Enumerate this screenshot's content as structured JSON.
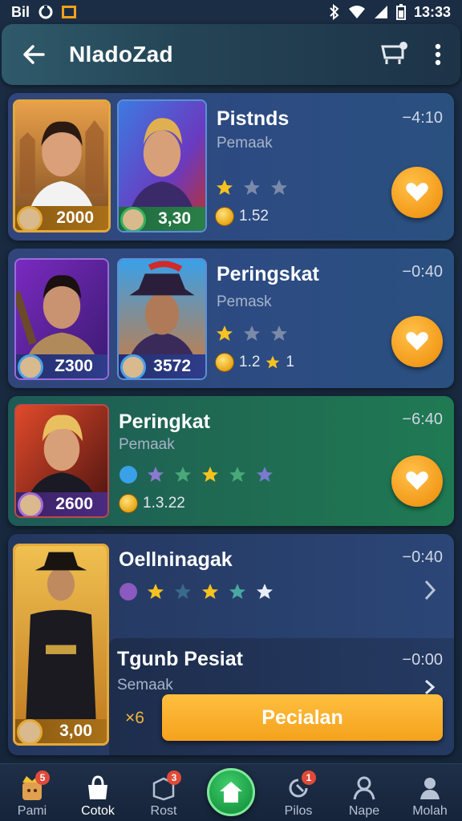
{
  "status_bar": {
    "left_text": "Bil",
    "time": "13:33"
  },
  "app_bar": {
    "title": "NladoZad",
    "back_icon": "arrow-left-icon",
    "cart_icon": "cart-icon",
    "menu_icon": "more-vertical-icon"
  },
  "cards": [
    {
      "title": "Pistnds",
      "subtitle": "Pemaak",
      "time": "−4:10",
      "portraits": [
        {
          "value": "2000"
        },
        {
          "value": "3,30"
        }
      ],
      "stars": 3,
      "coins": "1.52",
      "action_icon": "heart-icon"
    },
    {
      "title": "Peringskat",
      "subtitle": "Pemask",
      "time": "−0:40",
      "portraits": [
        {
          "value": "Z300"
        },
        {
          "value": "3572"
        }
      ],
      "stars": 3,
      "coins": "1.2",
      "coins_extra": "1",
      "action_icon": "heart-icon"
    },
    {
      "title": "Peringkat",
      "subtitle": "Pemaak",
      "time": "−6:40",
      "portraits": [
        {
          "value": "2600"
        }
      ],
      "stars": 6,
      "coins": "1.3.22",
      "action_icon": "heart-icon"
    },
    {
      "title": "Oellninagak",
      "time": "−0:40",
      "portraits": [
        {
          "value": "3,00"
        }
      ],
      "stars": 5,
      "action_icon": "chevron-right-icon"
    },
    {
      "title": "Tgunb Pesiat",
      "subtitle": "Semaak",
      "time": "−0:00",
      "multiplier": "×6",
      "button_label": "Pecialan",
      "action_icon": "chevron-right-icon"
    }
  ],
  "bottom_nav": [
    {
      "label": "Pami",
      "icon": "king-icon",
      "badge": ""
    },
    {
      "label": "Cotok",
      "icon": "bag-icon",
      "badge": ""
    },
    {
      "label": "Rost",
      "icon": "box-icon",
      "badge": ""
    },
    {
      "label": "",
      "icon": "home-icon",
      "badge": ""
    },
    {
      "label": "Pilos",
      "icon": "refresh-icon",
      "badge": ""
    },
    {
      "label": "Nape",
      "icon": "person-icon",
      "badge": ""
    },
    {
      "label": "Molah",
      "icon": "rank-icon",
      "badge": ""
    }
  ],
  "colors": {
    "accent_orange": "#f5a21d",
    "star_gold": "#f7c21f",
    "home_green": "#1d9c45"
  }
}
